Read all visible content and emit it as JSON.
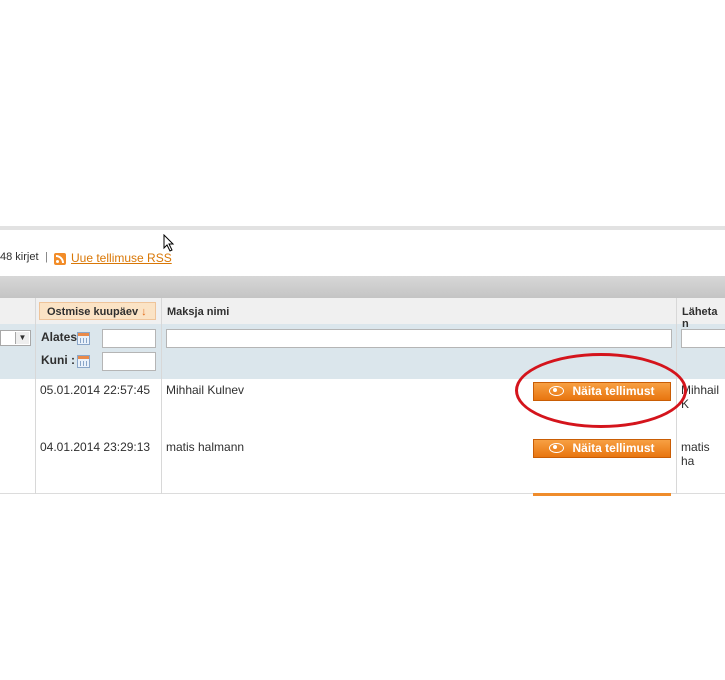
{
  "toolbar": {
    "records_text": "48 kirjet",
    "separator": "|",
    "rss_link": "Uue tellimuse RSS"
  },
  "columns": {
    "purchase_date": "Ostmise kuupäev",
    "sort_arrow": "↓",
    "payer_name": "Maksja nimi",
    "ship_to_partial": "Läheta n"
  },
  "filters": {
    "from_label": "Alates",
    "to_label": "Kuni :",
    "select_arrow": "▼"
  },
  "rows": [
    {
      "date": "05.01.2014 22:57:45",
      "payer": "Mihhail Kulnev",
      "action": "Näita tellimust",
      "ship_partial": "Mihhail K"
    },
    {
      "date": "04.01.2014 23:29:13",
      "payer": "matis halmann",
      "action": "Näita tellimust",
      "ship_partial": "matis ha"
    }
  ],
  "colors": {
    "button": "#ef8c2b",
    "highlight": "#d4141c",
    "link": "#d97706",
    "filter_bg": "#dbe6ec"
  }
}
